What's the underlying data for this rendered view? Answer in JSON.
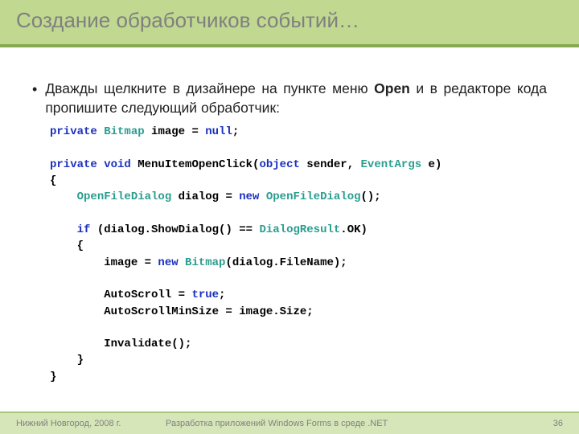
{
  "header": {
    "title": "Создание обработчиков событий…"
  },
  "content": {
    "bullet_html": "Дважды щелкните в дизайнере на пункте меню <b>Open</b> и в редакторе кода пропишите следующий обработчик:",
    "code_html": "<span class=\"kw\">private</span> <span class=\"type\">Bitmap</span> image = <span class=\"kw\">null</span>;\n\n<span class=\"kw\">private</span> <span class=\"kw\">void</span> MenuItemOpenClick(<span class=\"kw\">object</span> sender, <span class=\"type\">EventArgs</span> e)\n{\n    <span class=\"type\">OpenFileDialog</span> dialog = <span class=\"kw\">new</span> <span class=\"type\">OpenFileDialog</span>();\n\n    <span class=\"kw\">if</span> (dialog.ShowDialog() == <span class=\"type\">DialogResult</span>.OK)\n    {\n        image = <span class=\"kw\">new</span> <span class=\"type\">Bitmap</span>(dialog.FileName);\n\n        AutoScroll = <span class=\"kw\">true</span>;\n        AutoScrollMinSize = image.Size;\n\n        Invalidate();\n    }\n}"
  },
  "footer": {
    "location": "Нижний Новгород, 2008 г.",
    "course": "Разработка приложений Windows Forms в среде .NET",
    "page": "36"
  }
}
